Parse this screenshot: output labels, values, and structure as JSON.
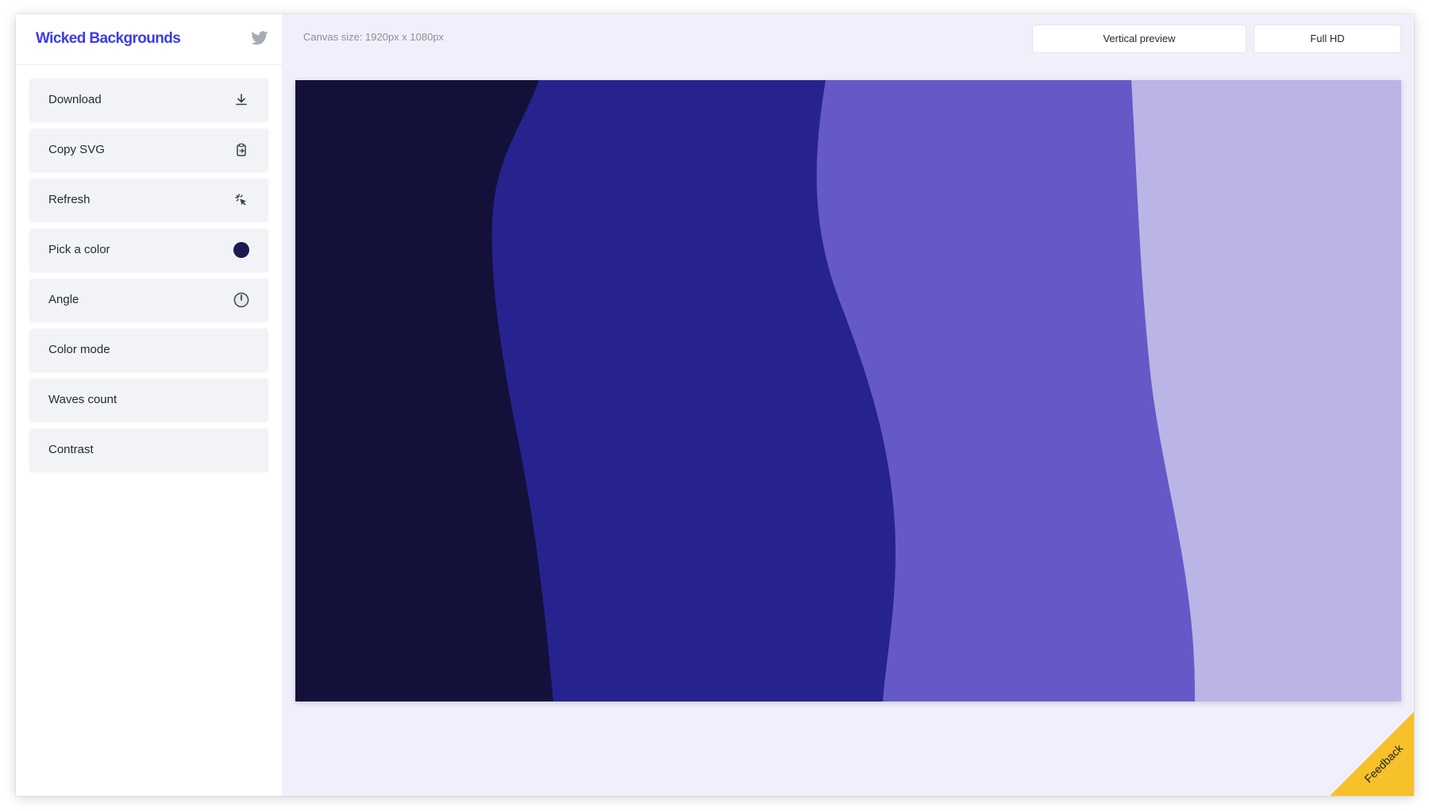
{
  "app": {
    "title": "Wicked Backgrounds"
  },
  "sidebar": {
    "items": [
      {
        "label": "Download",
        "icon": "download-icon"
      },
      {
        "label": "Copy SVG",
        "icon": "clipboard-icon"
      },
      {
        "label": "Refresh",
        "icon": "sparkle-cursor-icon"
      },
      {
        "label": "Pick a color",
        "icon": "color-swatch-icon"
      },
      {
        "label": "Angle",
        "icon": "clock-icon"
      },
      {
        "label": "Color mode",
        "icon": ""
      },
      {
        "label": "Waves count",
        "icon": ""
      },
      {
        "label": "Contrast",
        "icon": ""
      }
    ]
  },
  "header": {
    "canvas_size": "Canvas size: 1920px x 1080px",
    "vertical_preview": "Vertical preview",
    "full_hd": "Full HD"
  },
  "preview": {
    "colors": [
      "#13113a",
      "#26238f",
      "#6459c6",
      "#bab5e6"
    ]
  },
  "feedback": {
    "label": "Feedback"
  },
  "colors": {
    "brand": "#3b3ce6",
    "picked_color": "#1c1a4f",
    "feedback": "#f6c12b"
  }
}
